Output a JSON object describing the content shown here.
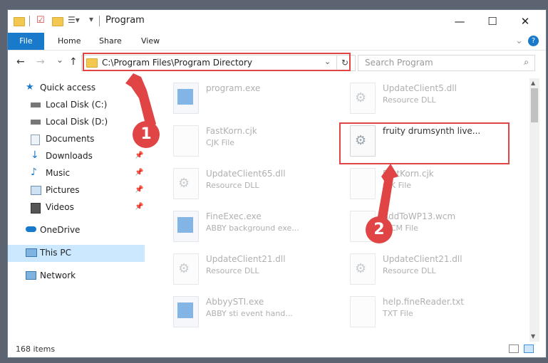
{
  "window": {
    "title": "Program",
    "minimize_icon": "minimize-icon",
    "maximize_icon": "maximize-icon",
    "close_icon": "close-icon",
    "help_label": "?"
  },
  "ribbon": {
    "tabs": [
      {
        "label": "File"
      },
      {
        "label": "Home"
      },
      {
        "label": "Share"
      },
      {
        "label": "View"
      }
    ]
  },
  "nav": {
    "address": "C:\\Program Files\\Program Directory",
    "search_placeholder": "Search Program",
    "back_glyph": "←",
    "forward_glyph": "→",
    "recent_glyph": "⌄",
    "up_glyph": "↑",
    "refresh_glyph": "↻",
    "search_glyph": "⌕",
    "drop_glyph": "⌄"
  },
  "sidebar": {
    "items": [
      {
        "label": "Quick access",
        "icon": "star-icon"
      },
      {
        "label": "Local Disk (C:)",
        "icon": "drive-icon"
      },
      {
        "label": "Local Disk (D:)",
        "icon": "drive-icon"
      },
      {
        "label": "Documents",
        "icon": "documents-icon"
      },
      {
        "label": "Downloads",
        "icon": "download-icon"
      },
      {
        "label": "Music",
        "icon": "music-icon"
      },
      {
        "label": "Pictures",
        "icon": "pictures-icon"
      },
      {
        "label": "Videos",
        "icon": "videos-icon"
      },
      {
        "label": "OneDrive",
        "icon": "cloud-icon"
      },
      {
        "label": "This PC",
        "icon": "computer-icon"
      },
      {
        "label": "Network",
        "icon": "network-icon"
      }
    ],
    "pin_glyph": "📌"
  },
  "files": [
    {
      "name": "program.exe",
      "type": ""
    },
    {
      "name": "UpdateClient5.dll",
      "type": "Resource DLL"
    },
    {
      "name": "FastKorn.cjk",
      "type": "CJK File"
    },
    {
      "name": "fruity drumsynth live...",
      "type": ""
    },
    {
      "name": "UpdateClient65.dll",
      "type": "Resource DLL"
    },
    {
      "name": "FastKorn.cjk",
      "type": "CJK File"
    },
    {
      "name": "FineExec.exe",
      "type": "ABBY background exe..."
    },
    {
      "name": "AddToWP13.wcm",
      "type": "WCM File"
    },
    {
      "name": "UpdateClient21.dll",
      "type": "Resource DLL"
    },
    {
      "name": "UpdateClient21.dll",
      "type": "Resource DLL"
    },
    {
      "name": "AbbyySTI.exe",
      "type": "ABBY sti event hand..."
    },
    {
      "name": "help.fineReader.txt",
      "type": "TXT File"
    }
  ],
  "status": {
    "count": "168 items"
  },
  "callouts": [
    {
      "label": "1"
    },
    {
      "label": "2"
    }
  ],
  "colors": {
    "accent": "#1979ca",
    "highlight": "#e04444",
    "selected": "#cce8ff"
  }
}
